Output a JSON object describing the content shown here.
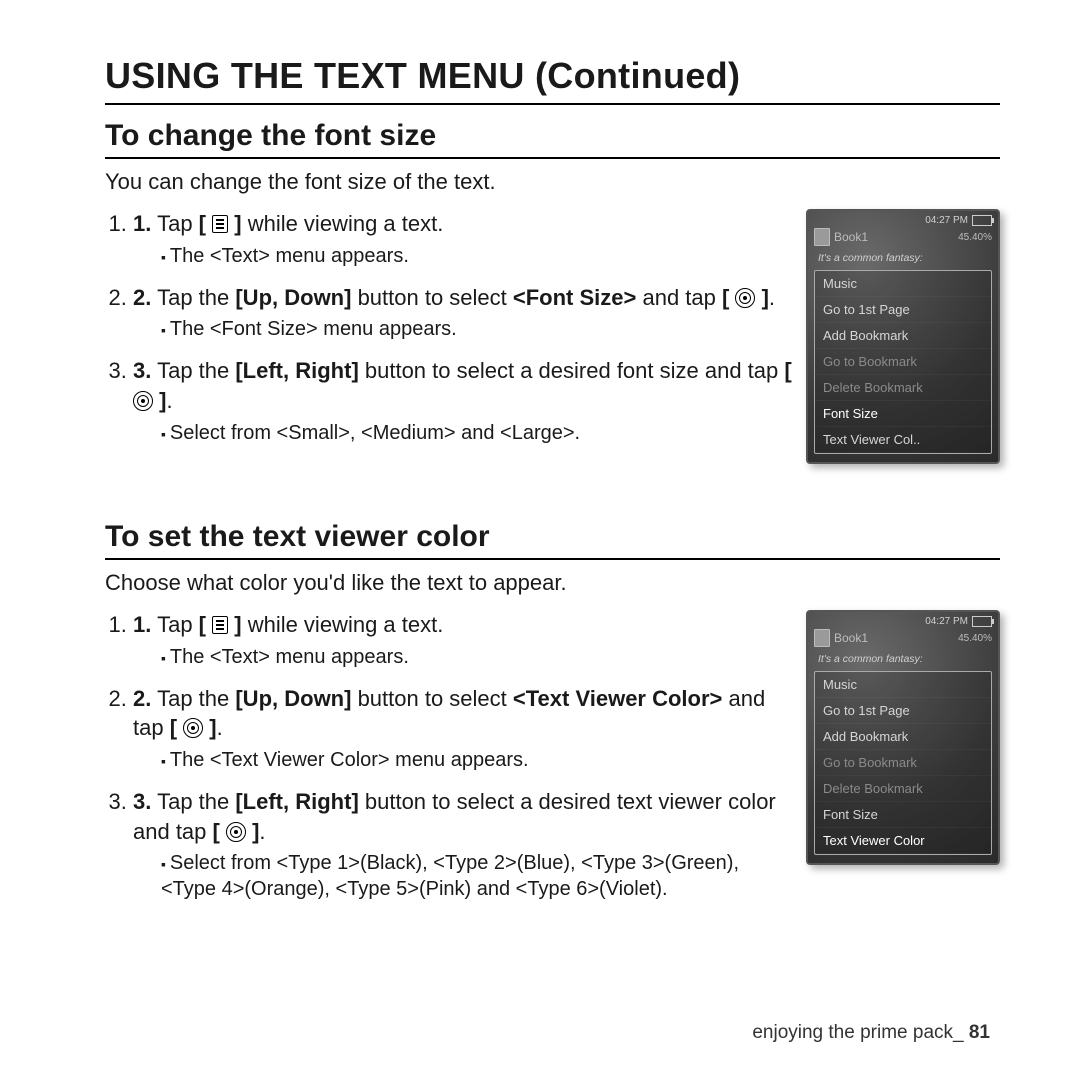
{
  "title": "USING THE TEXT MENU (Continued)",
  "sectionA": {
    "heading": "To change the font size",
    "intro": "You can change the font size of the text.",
    "s1a": "Tap ",
    "s1b": " while viewing a text.",
    "s1sub": "The <Text> menu appears.",
    "s2a": "Tap the ",
    "s2b": "[Up, Down]",
    "s2c": " button to select ",
    "s2d": "<Font Size>",
    "s2e": " and tap ",
    "s2sub": "The <Font Size> menu appears.",
    "s3a": "Tap the ",
    "s3b": "[Left, Right]",
    "s3c": " button to select a desired font size and tap ",
    "s3sub": "Select from <Small>, <Medium> and <Large>."
  },
  "sectionB": {
    "heading": "To set the text viewer color",
    "intro": "Choose what color you'd like the text to appear.",
    "s1a": "Tap ",
    "s1b": " while viewing a text.",
    "s1sub": "The <Text> menu appears.",
    "s2a": "Tap the ",
    "s2b": "[Up, Down]",
    "s2c": " button to select ",
    "s2d": "<Text Viewer Color>",
    "s2e": " and tap ",
    "s2sub": "The <Text Viewer Color> menu appears.",
    "s3a": "Tap the ",
    "s3b": "[Left, Right]",
    "s3c": " button to select a desired text viewer color and tap ",
    "s3sub": "Select from <Type 1>(Black), <Type 2>(Blue), <Type 3>(Green), <Type 4>(Orange), <Type 5>(Pink) and <Type 6>(Violet)."
  },
  "bracketOpen": "[ ",
  "bracketClose": " ]",
  "period": ".",
  "device": {
    "time": "04:27 PM",
    "title": "Book1",
    "percent": "45.40%",
    "fantasy": "It's a common fantasy:",
    "items": [
      "Music",
      "Go to 1st Page",
      "Add Bookmark",
      "Go to Bookmark",
      "Delete Bookmark",
      "Font Size",
      "Text Viewer Col.."
    ],
    "itemsB": [
      "Music",
      "Go to 1st Page",
      "Add Bookmark",
      "Go to Bookmark",
      "Delete Bookmark",
      "Font Size",
      "Text Viewer Color"
    ]
  },
  "footer": {
    "text": "enjoying the prime pack_ ",
    "page": "81"
  }
}
